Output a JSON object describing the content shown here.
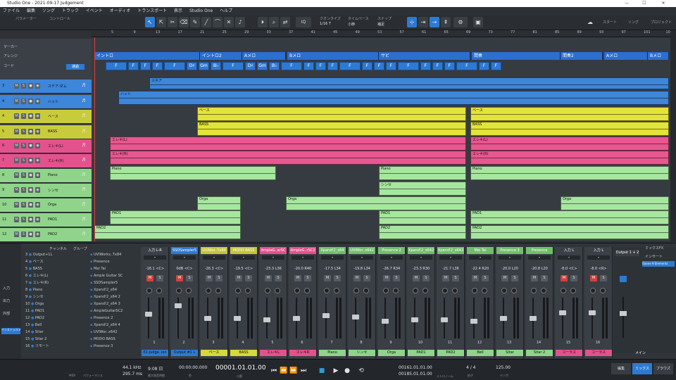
{
  "titlebar": {
    "title": "Studio One - 2021-09-17 Judgement",
    "minimize": "—",
    "maximize": "☐",
    "close": "✕"
  },
  "menubar": [
    "ファイル",
    "編集",
    "ソング",
    "トラック",
    "イベント",
    "オーディオ",
    "トランスポート",
    "表示",
    "Studio One",
    "ヘルプ"
  ],
  "toolbar": {
    "param_label": "パラメーター",
    "control_label": "コントロール",
    "quantize_label": "クオンタイズ",
    "quantize_value": "1/16 T",
    "timebase_label": "タイムベース",
    "timebase_value": "小節",
    "snap_label": "スナップ",
    "snap_value": "補足",
    "start_label": "スタート",
    "song_label": "ソング",
    "project_label": "プロジェクト",
    "iq": "IQ"
  },
  "left_panel": {
    "marker_label": "マーカー",
    "arrange_label": "アレンジ",
    "chord_label": "コード",
    "chord_button": "通過"
  },
  "tracks": [
    {
      "num": "3",
      "name": "ステア-ダム",
      "color": "#3d86d9"
    },
    {
      "num": "4",
      "name": "ハット",
      "color": "#3d86d9"
    },
    {
      "num": "4",
      "name": "ベース",
      "color": "#c9cc3a"
    },
    {
      "num": "5",
      "name": "BASS",
      "color": "#c9cc3a"
    },
    {
      "num": "6",
      "name": "エレキ(L)",
      "color": "#e3528c"
    },
    {
      "num": "7",
      "name": "エレキ(R)",
      "color": "#e3528c"
    },
    {
      "num": "8",
      "name": "Piano",
      "color": "#8fd48a"
    },
    {
      "num": "9",
      "name": "シンセ",
      "color": "#8fd48a"
    },
    {
      "num": "10",
      "name": "Orga",
      "color": "#8fd48a"
    },
    {
      "num": "11",
      "name": "PAD1",
      "color": "#8fd48a"
    },
    {
      "num": "12",
      "name": "PAD2",
      "color": "#8fd48a"
    }
  ],
  "ruler": [
    "5",
    "9",
    "13",
    "17",
    "21",
    "25",
    "29",
    "33",
    "37",
    "41",
    "45",
    "49",
    "53",
    "57",
    "61",
    "65",
    "69",
    "73",
    "77",
    "81",
    "85",
    "89",
    "93",
    "97",
    "101",
    "105"
  ],
  "markers": [
    {
      "label": "イントロ"
    },
    {
      "label": "イントロ2"
    },
    {
      "label": "Aメロ"
    },
    {
      "label": "Bメロ"
    },
    {
      "label": "サビ"
    },
    {
      "label": "間奏"
    },
    {
      "label": "間奏2"
    },
    {
      "label": "Aメロ"
    },
    {
      "label": "Bメロ"
    }
  ],
  "chords": [
    "F",
    "F",
    "F",
    "F",
    "F",
    "D♯",
    "Gm",
    "B♭",
    "F",
    "D♯",
    "Gm",
    "B♭",
    "F",
    "F",
    "F",
    "F",
    "F",
    "F",
    "F",
    "F",
    "F",
    "F",
    "F",
    "F",
    "F",
    "F",
    "F"
  ],
  "clip_labels": {
    "drum": "スネア",
    "hat": "ハット",
    "bass_jp": "ベース",
    "bass": "BASS",
    "gtl": "エレキ(L)",
    "gtr": "エレキ(R)",
    "piano": "Piano",
    "synth": "シンセ",
    "orga": "Orga",
    "pad1": "PAD1",
    "pad2": "PAD2"
  },
  "mixer_list": {
    "header_channel": "チャンネル",
    "header_group": "グループ",
    "channels": [
      "Output+1L",
      "ベース",
      "BASS",
      "エレキ(L)",
      "エレキ(R)",
      "Piano",
      "シンセ",
      "Orga",
      "PAD1",
      "PAD2",
      "Bell",
      "Sitar",
      "Sitar 2",
      "リモート"
    ],
    "nums": [
      "3",
      "4",
      "5",
      "6",
      "7",
      "8",
      "9",
      "10",
      "11",
      "12",
      "13",
      "14",
      "15",
      "16"
    ],
    "instruments": [
      "UVIWorks..Tx84",
      "Presence",
      "Mai Tai",
      "Ample Guitar SC",
      "SSDSampler5",
      "Xpand!2_x64",
      "Xpand!2_x64 2",
      "Xpand!2_x64 3",
      "AmpleGuitarSC2",
      "Presence 2",
      "Xpand!2_x64 4",
      "UVIWor..x642",
      "MODO BASS",
      "Presence 3"
    ],
    "side_tabs": [
      "入力",
      "出力",
      "外部",
      "インストゥルメント"
    ]
  },
  "strips": [
    {
      "name": "入力 L-R",
      "vol": "-16.1",
      "pan": "<C>",
      "num": "1",
      "label": "01-Judge..ion",
      "color": "#2e7ad1",
      "head": "#3b4047"
    },
    {
      "name": "SSDSampler5",
      "vol": "0dB",
      "pan": "<C>",
      "num": "2",
      "label": "Output #1 L",
      "color": "#2e7ad1",
      "head": "#2e7ad1"
    },
    {
      "name": "UVIWor..Tx84",
      "vol": "-26.3",
      "pan": "<C>",
      "num": "3",
      "label": "ベース",
      "color": "#d6d83c",
      "head": "#c4c63a"
    },
    {
      "name": "MODO BASS",
      "vol": "-19.5",
      "pan": "<C>",
      "num": "4",
      "label": "BASS",
      "color": "#d6d83c",
      "head": "#c4c63a"
    },
    {
      "name": "AmpleG..arSC",
      "vol": "-23.3",
      "pan": "L36",
      "num": "5",
      "label": "エレキL",
      "color": "#e3528c",
      "head": "#e3528c"
    },
    {
      "name": "AmpleG..rSC2",
      "vol": "-20.0",
      "pan": "R40",
      "num": "6",
      "label": "エレキR",
      "color": "#e3528c",
      "head": "#e3528c"
    },
    {
      "name": "Xpand!2_x64",
      "vol": "-17.5",
      "pan": "L34",
      "num": "7",
      "label": "Piano",
      "color": "#8fd48a",
      "head": "#6fbf6a"
    },
    {
      "name": "UVIWor..x642",
      "vol": "-19.8",
      "pan": "L34",
      "num": "8",
      "label": "シンセ",
      "color": "#8fd48a",
      "head": "#6fbf6a"
    },
    {
      "name": "Presence 2",
      "vol": "-26.7",
      "pan": "R34",
      "num": "9",
      "label": "Orga",
      "color": "#8fd48a",
      "head": "#6fbf6a"
    },
    {
      "name": "Xpand!2_x642",
      "vol": "-23.3",
      "pan": "R30",
      "num": "10",
      "label": "PAD1",
      "color": "#8fd48a",
      "head": "#6fbf6a"
    },
    {
      "name": "Xpand!2_x643",
      "vol": "-21.7",
      "pan": "L36",
      "num": "11",
      "label": "PAD2",
      "color": "#8fd48a",
      "head": "#6fbf6a"
    },
    {
      "name": "Mai Tai",
      "vol": "-22.4",
      "pan": "R20",
      "num": "12",
      "label": "Bell",
      "color": "#8fd48a",
      "head": "#6fbf6a"
    },
    {
      "name": "Presence 3",
      "vol": "-20.0",
      "pan": "L20",
      "num": "13",
      "label": "Sitar",
      "color": "#8fd48a",
      "head": "#6fbf6a"
    },
    {
      "name": "Presence",
      "vol": "-20.8",
      "pan": "L20",
      "num": "14",
      "label": "Sitar 2",
      "color": "#8fd48a",
      "head": "#6fbf6a"
    },
    {
      "name": "入力 L",
      "vol": "-8.0",
      "pan": "<C>",
      "num": "15",
      "label": "コーラス",
      "color": "#e3528c",
      "head": "#3b4047"
    },
    {
      "name": "入力 L",
      "vol": "-8.0",
      "pan": "<R>",
      "num": "16",
      "label": "コーラス",
      "color": "#e3528c",
      "head": "#3b4047"
    }
  ],
  "main_strip": {
    "name": "Output 1 + 2",
    "label": "メイン",
    "mixfx": "ミックスFX",
    "insert": "インサート",
    "preset": "Ozone 9 Elements"
  },
  "transport": {
    "midi": "MIDI",
    "perf": "パフォーマンス",
    "rate": "44.1 kHz",
    "latency": "295.7 ms",
    "time": "9:08 日",
    "remaining": "最大録音時間",
    "timecode": "00:00:00.000",
    "timecode_unit": "秒",
    "position": "00001.01.01.00",
    "position_unit": "小節",
    "loop_start": "00161.01.01.00",
    "loop_end": "00185.01.01.00",
    "sig": "4 / 4",
    "sig_label": "拍子",
    "tempo": "125.00",
    "tempo_label": "テンポ",
    "metronome": "メトロノーム",
    "edit": "編集",
    "mix": "ミックス",
    "browse": "ブラウズ"
  }
}
